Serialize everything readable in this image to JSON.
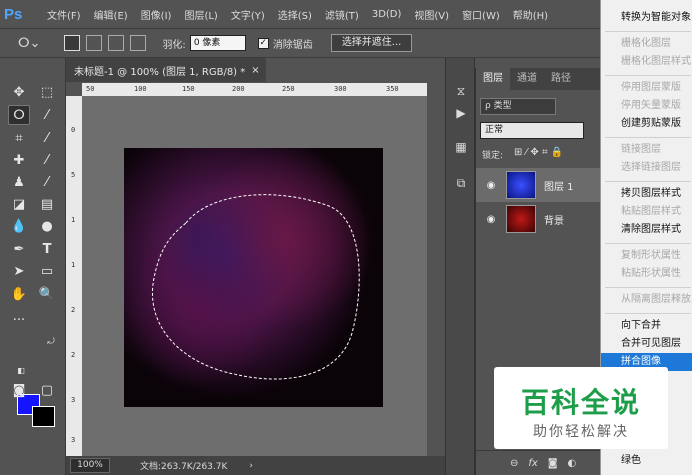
{
  "app": {
    "logo": "Ps"
  },
  "menubar": {
    "items": [
      "文件(F)",
      "编辑(E)",
      "图像(I)",
      "图层(L)",
      "文字(Y)",
      "选择(S)",
      "滤镜(T)",
      "3D(D)",
      "视图(V)",
      "窗口(W)",
      "帮助(H)"
    ]
  },
  "options": {
    "feather_label": "羽化:",
    "feather_value": "0 像素",
    "antialias_label": "消除锯齿",
    "antialias_checked": true,
    "select_mask_button": "选择并遮住..."
  },
  "document": {
    "tab_title": "未标题-1 @ 100% (图层 1, RGB/8) *",
    "ruler_h": [
      "50",
      "100",
      "150",
      "200",
      "250",
      "300",
      "350"
    ],
    "ruler_v": [
      "0",
      "5",
      "1",
      "1",
      "2",
      "2",
      "3",
      "3"
    ]
  },
  "colors": {
    "foreground": "#1414ff",
    "background": "#000000",
    "menu_highlight": "#1e78d7"
  },
  "status": {
    "zoom": "100%",
    "doc_size": "文档:263.7K/263.7K",
    "arrow": "›"
  },
  "layers_panel": {
    "tabs": [
      "图层",
      "通道",
      "路径"
    ],
    "filter": "ρ 类型",
    "blend_mode": "正常",
    "lock_label": "锁定:",
    "layers": [
      {
        "name": "图层 1",
        "selected": true,
        "thumb_color": "#1a2bd6"
      },
      {
        "name": "背景",
        "selected": false,
        "thumb_color": "#8a0a0a"
      }
    ],
    "bottom_icons": [
      "link-icon",
      "fx-icon",
      "mask-icon",
      "adjustment-icon"
    ]
  },
  "context_menu": {
    "items": [
      {
        "label": "转换为智能对象",
        "enabled": true
      },
      {
        "label": "栅格化图层",
        "enabled": false
      },
      {
        "label": "栅格化图层样式",
        "enabled": false
      },
      {
        "label": "停用图层蒙版",
        "enabled": false
      },
      {
        "label": "停用矢量蒙版",
        "enabled": false
      },
      {
        "label": "创建剪贴蒙版",
        "enabled": true
      },
      {
        "label": "链接图层",
        "enabled": false
      },
      {
        "label": "选择链接图层",
        "enabled": false
      },
      {
        "label": "拷贝图层样式",
        "enabled": true
      },
      {
        "label": "粘贴图层样式",
        "enabled": false
      },
      {
        "label": "清除图层样式",
        "enabled": true
      },
      {
        "label": "复制形状属性",
        "enabled": false
      },
      {
        "label": "粘贴形状属性",
        "enabled": false
      },
      {
        "label": "从隔离图层释放",
        "enabled": false
      },
      {
        "label": "向下合并",
        "enabled": true
      },
      {
        "label": "合并可见图层",
        "enabled": true
      },
      {
        "label": "拼合图像",
        "enabled": true,
        "highlighted": true
      },
      {
        "label": "绿色",
        "enabled": true
      }
    ]
  },
  "watermark": {
    "main": "百科全说",
    "sub": "助你轻松解决"
  }
}
